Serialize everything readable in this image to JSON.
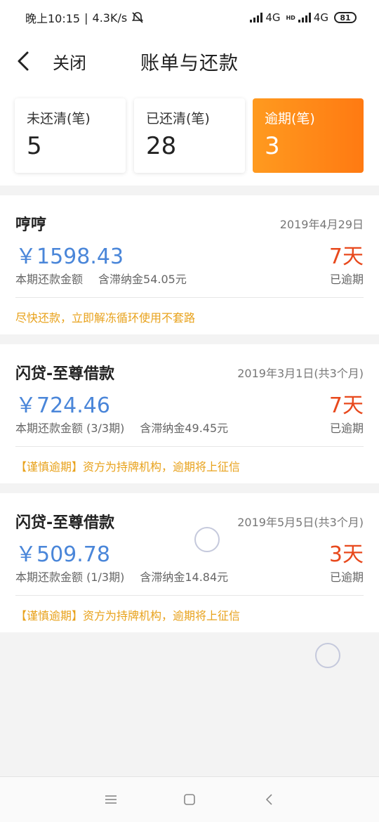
{
  "status_bar": {
    "time": "晚上10:15",
    "separator": "|",
    "speed": "4.3K/s",
    "network1": "4G",
    "network2": "4G",
    "hd_label": "HD",
    "battery": "81",
    "icons": [
      "mute-bell-icon",
      "signal-icon",
      "battery-icon"
    ]
  },
  "header": {
    "back_icon": "chevron-left-icon",
    "close_label": "关闭",
    "title": "账单与还款"
  },
  "summary": [
    {
      "label": "未还清(笔)",
      "value": "5",
      "active": false
    },
    {
      "label": "已还清(笔)",
      "value": "28",
      "active": false
    },
    {
      "label": "逾期(笔)",
      "value": "3",
      "active": true
    }
  ],
  "loans": [
    {
      "name": "哼哼",
      "date": "2019年4月29日",
      "amount": "￥1598.43",
      "amount_label": "本期还款金额",
      "fee": "含滞纳金54.05元",
      "days": "7天",
      "status": "已逾期",
      "tip": "尽快还款，立即解冻循环使用不套路"
    },
    {
      "name": "闪贷-至尊借款",
      "date": "2019年3月1日(共3个月)",
      "amount": "￥724.46",
      "amount_label": "本期还款金额 (3/3期)",
      "fee": "含滞纳金49.45元",
      "days": "7天",
      "status": "已逾期",
      "tip": "【谨慎逾期】资方为持牌机构，逾期将上征信"
    },
    {
      "name": "闪贷-至尊借款",
      "date": "2019年5月5日(共3个月)",
      "amount": "￥509.78",
      "amount_label": "本期还款金额 (1/3期)",
      "fee": "含滞纳金14.84元",
      "days": "3天",
      "status": "已逾期",
      "tip": "【谨慎逾期】资方为持牌机构，逾期将上征信"
    }
  ],
  "nav": {
    "icons": [
      "menu-icon",
      "home-square-icon",
      "back-triangle-icon"
    ]
  },
  "colors": {
    "accent_orange": "#ff8a1a",
    "amount_blue": "#4a86d9",
    "overdue_red": "#e8491d",
    "tip_orange": "#e8a21c"
  }
}
